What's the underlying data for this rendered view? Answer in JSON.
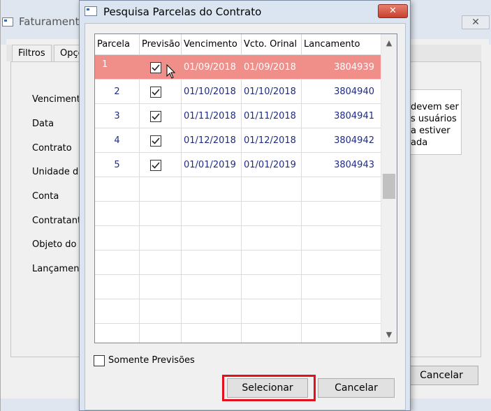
{
  "background_window": {
    "title": "Faturamento",
    "close_glyph": "✕",
    "tabs": [
      "Filtros",
      "Opçõ"
    ],
    "labels": [
      "Vencimento",
      "Data",
      "Contrato",
      "Unidade de",
      "Conta",
      "Contratant",
      "Objeto do",
      "Lançament"
    ],
    "info_text": [
      "devem ser",
      "s usuários",
      "a estiver",
      "ada"
    ],
    "cancel_label": "Cancelar"
  },
  "dialog": {
    "title": "Pesquisa Parcelas do Contrato",
    "close_glyph": "✕",
    "columns": [
      "Parcela",
      "Previsão",
      "Vencimento",
      "Vcto. Orinal",
      "Lancamento"
    ],
    "rows": [
      {
        "parcela": "1",
        "previsao": true,
        "vencimento": "01/09/2018",
        "vcto_original": "01/09/2018",
        "lancamento": "3804939",
        "selected": true
      },
      {
        "parcela": "2",
        "previsao": true,
        "vencimento": "01/10/2018",
        "vcto_original": "01/10/2018",
        "lancamento": "3804940",
        "selected": false
      },
      {
        "parcela": "3",
        "previsao": true,
        "vencimento": "01/11/2018",
        "vcto_original": "01/11/2018",
        "lancamento": "3804941",
        "selected": false
      },
      {
        "parcela": "4",
        "previsao": true,
        "vencimento": "01/12/2018",
        "vcto_original": "01/12/2018",
        "lancamento": "3804942",
        "selected": false
      },
      {
        "parcela": "5",
        "previsao": true,
        "vencimento": "01/01/2019",
        "vcto_original": "01/01/2019",
        "lancamento": "3804943",
        "selected": false
      }
    ],
    "somente_previsoes_label": "Somente Previsões",
    "somente_previsoes_checked": false,
    "select_label": "Selecionar",
    "cancel_label": "Cancelar",
    "scroll_up_glyph": "▲",
    "scroll_down_glyph": "▼"
  },
  "colors": {
    "selected_row": "#f08e8a",
    "cell_text": "#1e2c83",
    "highlight_border": "#e3101d",
    "close_button": "#c7402d"
  }
}
